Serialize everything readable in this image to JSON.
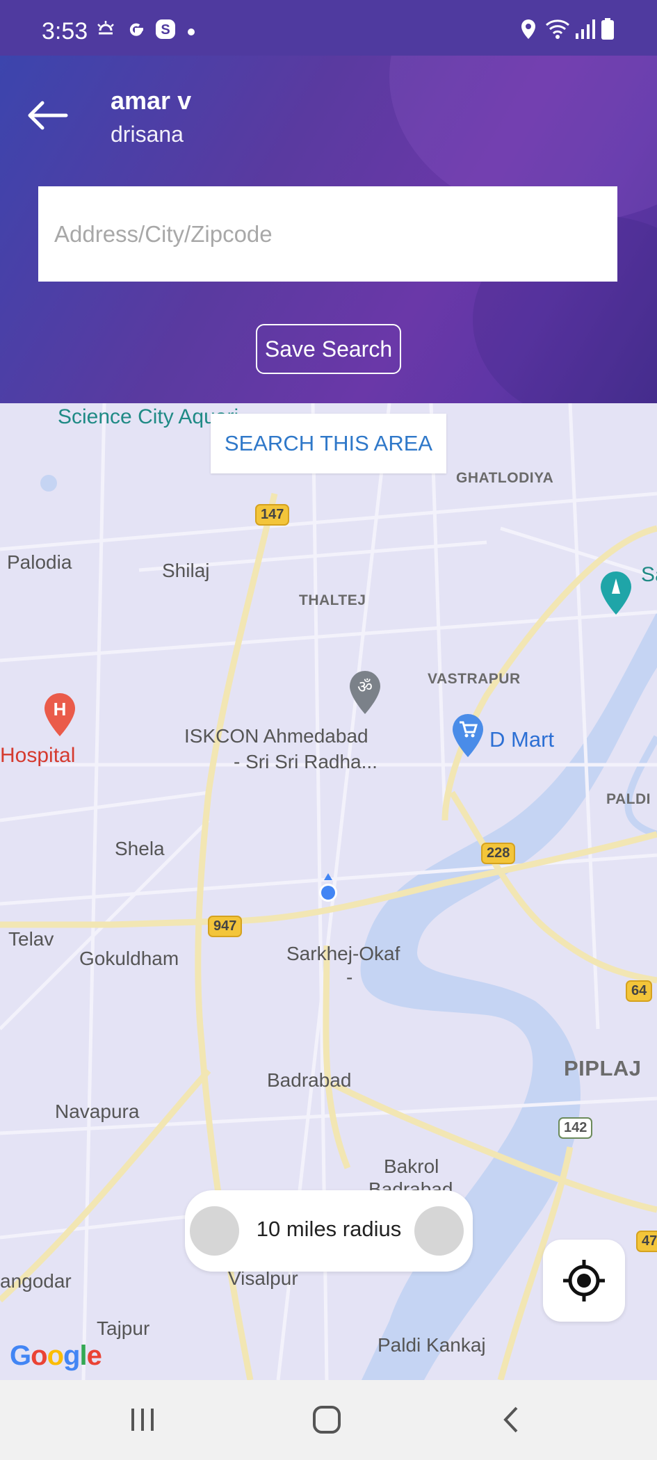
{
  "status_bar": {
    "time": "3:53",
    "icons": [
      "weather-icon",
      "google-icon",
      "s-app-icon",
      "dot-icon",
      "location-icon",
      "wifi-icon",
      "signal-icon",
      "battery-icon"
    ]
  },
  "header": {
    "back_icon": "arrow-left-icon",
    "user_name": "amar v",
    "user_subtitle": "drisana",
    "search_placeholder": "Address/City/Zipcode",
    "search_value": "",
    "save_search_label": "Save Search"
  },
  "map": {
    "search_area_label": "SEARCH THIS AREA",
    "labels": {
      "science_city": "Science City Aquari",
      "ghatlodiya": "GHATLODIYA",
      "palodia": "Palodia",
      "shilaj": "Shilaj",
      "thaltej": "THALTEJ",
      "sa": "Sa",
      "vastrapur": "VASTRAPUR",
      "iskcon_1": "ISKCON Ahmedabad",
      "iskcon_2": "- Sri Sri Radha...",
      "dmart": "D Mart",
      "hospital": "Hospital",
      "paldi": "PALDI",
      "shela": "Shela",
      "telav": "Telav",
      "gokuldham": "Gokuldham",
      "sarkhej_1": "Sarkhej-Okaf",
      "sarkhej_2": "-",
      "piplaj": "PIPLAJ",
      "badrabad": "Badrabad",
      "navapura": "Navapura",
      "bakrol_1": "Bakrol",
      "bakrol_2": "Badrabad",
      "sangodar": "angodar",
      "visalpur": "Visalpur",
      "tajpur": "Tajpur",
      "paldi_kankaj": "Paldi Kankaj"
    },
    "shields": {
      "r147": "147",
      "r228": "228",
      "r947": "947",
      "r64": "64",
      "r142": "142",
      "r47": "47"
    },
    "radius_label": "10 miles radius",
    "locate_icon": "my-location-icon",
    "attribution": "Google",
    "colors": {
      "land": "#e4e3f5",
      "water": "#c5d4f3",
      "road_major": "#f4e7b5",
      "accent_blue": "#2f78c9"
    }
  },
  "nav_bar": {
    "recents_icon": "recents-icon",
    "home_icon": "home-icon",
    "back_icon": "back-chevron-icon"
  }
}
